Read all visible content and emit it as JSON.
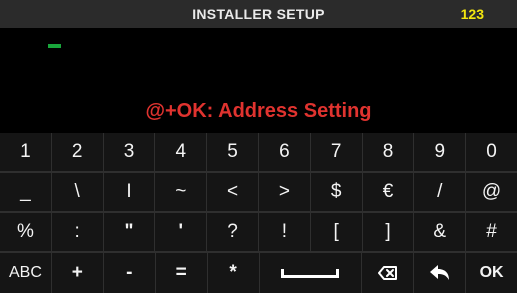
{
  "header": {
    "title": "INSTALLER SETUP",
    "code": "123"
  },
  "hint": "@+OK: Address Setting",
  "keyboard": {
    "rows": [
      [
        "1",
        "2",
        "3",
        "4",
        "5",
        "6",
        "7",
        "8",
        "9",
        "0"
      ],
      [
        "_",
        "\\",
        "I",
        "~",
        "<",
        ">",
        "$",
        "€",
        "/",
        "@"
      ],
      [
        "%",
        ":",
        "\"",
        "'",
        "?",
        "!",
        "[",
        "]",
        "&",
        "#"
      ],
      [
        "ABC",
        "+",
        "-",
        "=",
        "*",
        "",
        "",
        "",
        "",
        "OK"
      ]
    ]
  },
  "colors": {
    "title": "#eaeaea",
    "code": "#f3e60f",
    "hint": "#e0332f",
    "cursor": "#19a63b",
    "topbar": "#2b2b2b",
    "keyboard": "#151515"
  },
  "icons": {
    "space": "space-bar-icon",
    "backspace": "backspace-icon",
    "back": "back-arrow-icon"
  }
}
